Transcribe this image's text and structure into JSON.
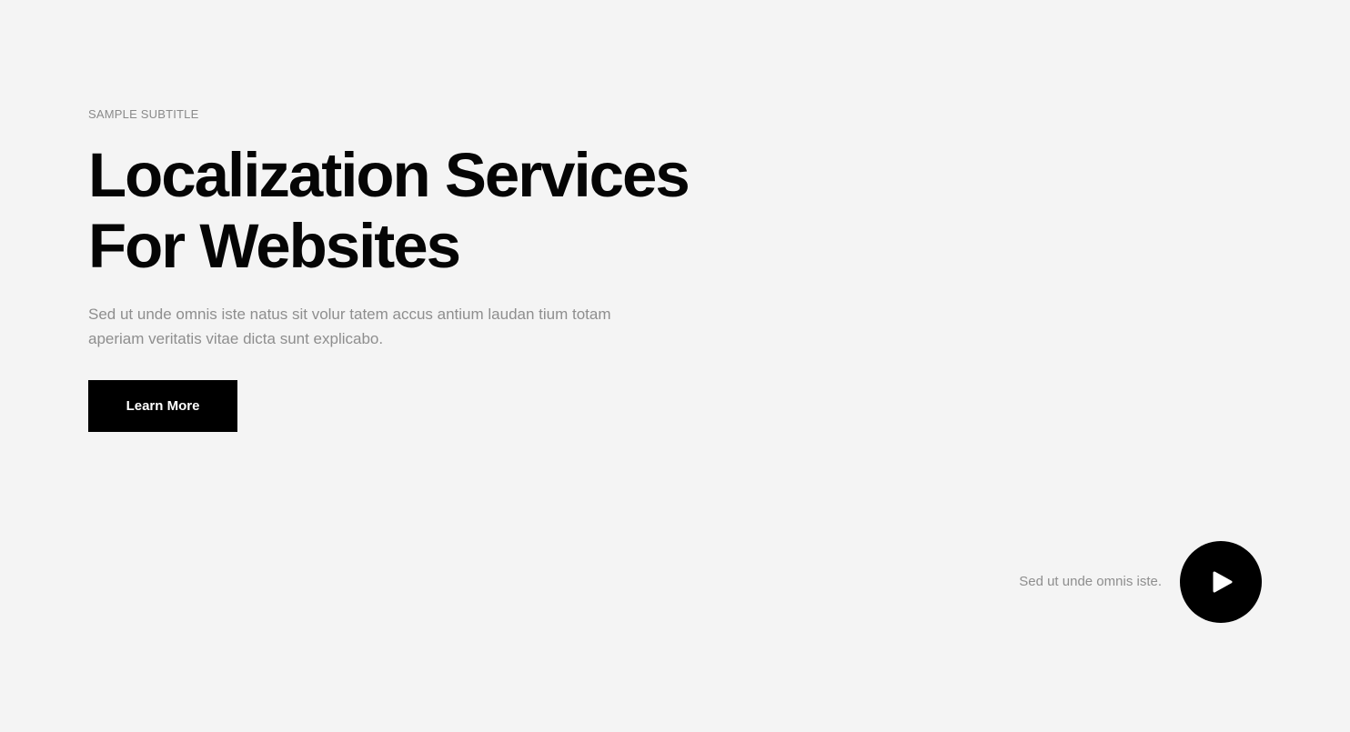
{
  "hero": {
    "subtitle": "SAMPLE SUBTITLE",
    "title_line1": "Localization Services",
    "title_line2": "For Websites",
    "description": "Sed ut unde omnis iste natus sit volur tatem accus antium laudan tium totam aperiam veritatis vitae dicta sunt explicabo.",
    "cta_label": "Learn More"
  },
  "video": {
    "caption": "Sed ut unde omnis iste.",
    "icon": "play-icon"
  },
  "colors": {
    "background": "#f4f4f4",
    "primary": "#000000",
    "muted_text": "#8e8e8e"
  }
}
